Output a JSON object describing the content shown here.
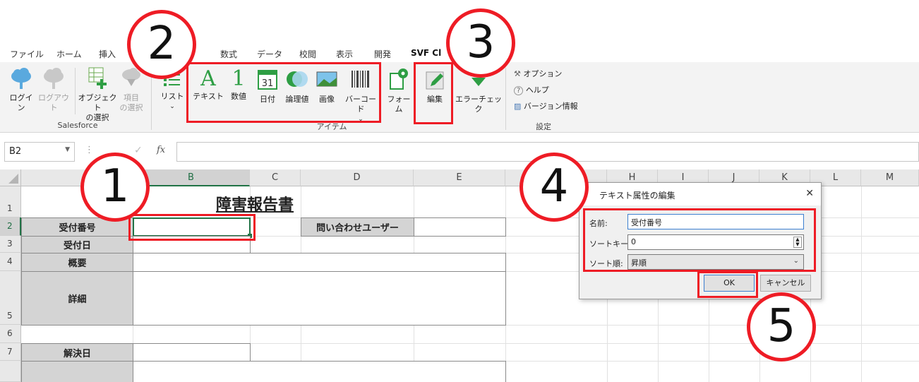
{
  "ribbon": {
    "tabs": [
      "ファイル",
      "ホーム",
      "挿入",
      "数式",
      "データ",
      "校閲",
      "表示",
      "開発",
      "SVF Cl"
    ],
    "salesforce_group": {
      "label": "Salesforce",
      "login": "ログイン",
      "logout": "ログアウト",
      "object_select": "オブジェクト\nの選択",
      "item_select": "項目\nの選択"
    },
    "items_group": {
      "label": "アイテム",
      "list": "リスト",
      "text": "テキスト",
      "number": "数値",
      "date": "日付",
      "logical": "論理値",
      "image": "画像",
      "barcode": "バーコード",
      "form": "フォーム",
      "edit": "編集",
      "error_check": "エラーチェック"
    },
    "settings_group": {
      "label": "設定",
      "options": "オプション",
      "help": "ヘルプ",
      "version": "バージョン情報"
    }
  },
  "formula_bar": {
    "namebox": "B2",
    "fx": "fx"
  },
  "columns": [
    "B",
    "C",
    "D",
    "E",
    "H",
    "I",
    "J",
    "K",
    "L",
    "M"
  ],
  "rows": [
    "1",
    "2",
    "3",
    "4",
    "5",
    "6",
    "7"
  ],
  "sheet": {
    "title": "障害報告書",
    "label_receipt_no": "受付番号",
    "label_receipt_date": "受付日",
    "label_summary": "概要",
    "label_detail": "詳細",
    "label_resolved_date": "解決日",
    "label_inquiry_user": "問い合わせユーザー"
  },
  "dialog": {
    "title": "テキスト属性の編集",
    "name_label": "名前:",
    "name_value": "受付番号",
    "sortkey_label": "ソートキー:",
    "sortkey_value": "0",
    "sortorder_label": "ソート順:",
    "sortorder_value": "昇順",
    "ok": "OK",
    "cancel": "キャンセル"
  },
  "callouts": [
    "1",
    "2",
    "3",
    "4",
    "5"
  ],
  "colors": {
    "callout_red": "#ee1c25",
    "excel_green": "#217346",
    "header_gray": "#d4d4d4"
  }
}
